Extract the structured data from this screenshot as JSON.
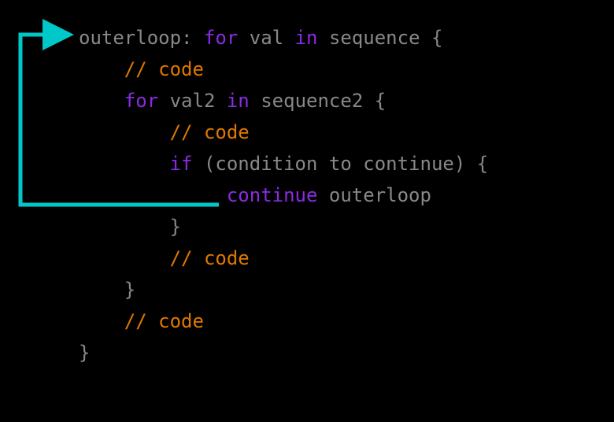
{
  "code": {
    "l1": {
      "label": "outerloop:",
      "kw_for": "for",
      "var": "val",
      "kw_in": "in",
      "seq": "sequence",
      "brace": "{"
    },
    "l2": {
      "comment": "// code"
    },
    "l3": {
      "kw_for": "for",
      "var": "val2",
      "kw_in": "in",
      "seq": "sequence2",
      "brace": "{"
    },
    "l4": {
      "comment": "// code"
    },
    "l5": {
      "kw_if": "if",
      "cond": "(condition to continue)",
      "brace": "{"
    },
    "l6": {
      "kw_continue": "continue",
      "target": "outerloop"
    },
    "l7": {
      "brace": "}"
    },
    "l8": {
      "comment": "// code"
    },
    "l9": {
      "brace": "}"
    },
    "l10": {
      "comment": "// code"
    },
    "l11": {
      "brace": "}"
    }
  },
  "arrow": {
    "color": "#00c8c8"
  }
}
